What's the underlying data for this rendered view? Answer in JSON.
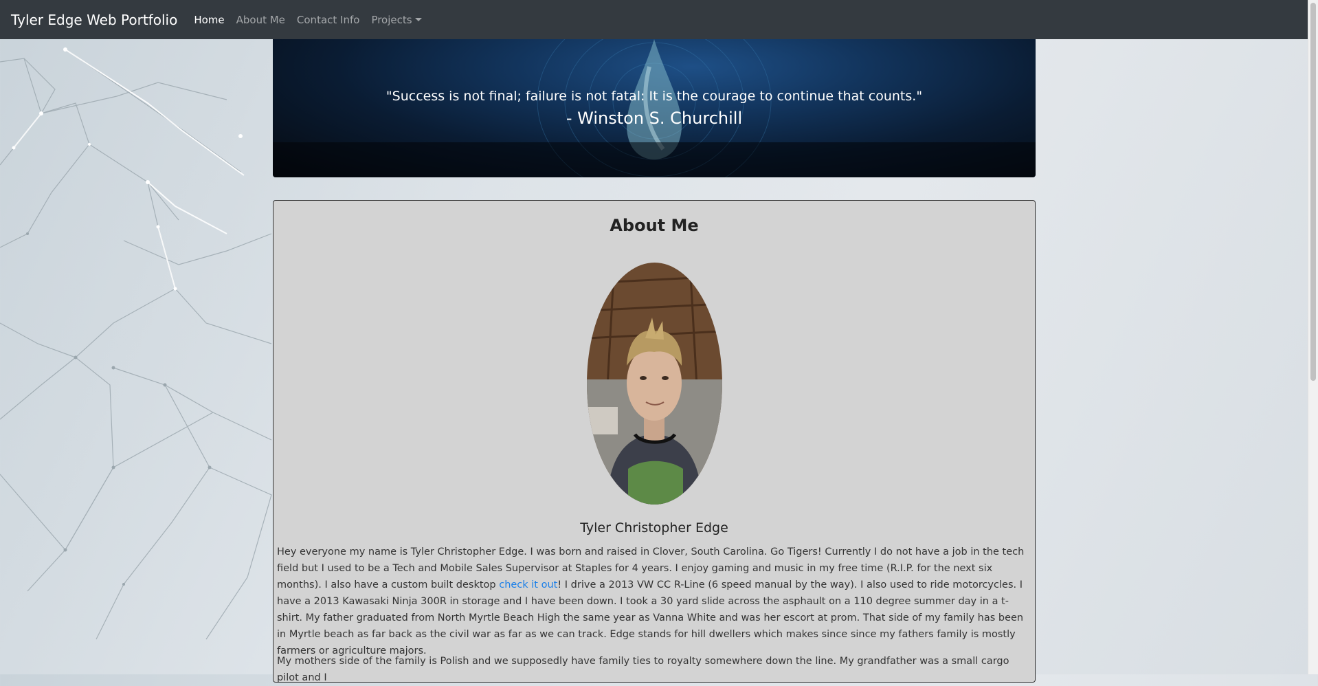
{
  "navbar": {
    "brand": "Tyler Edge Web Portfolio",
    "links": [
      {
        "label": "Home",
        "active": true
      },
      {
        "label": "About Me",
        "active": false
      },
      {
        "label": "Contact Info",
        "active": false
      },
      {
        "label": "Projects",
        "active": false,
        "dropdown": true
      }
    ]
  },
  "hero": {
    "quote": "\"Success is not final; failure is not fatal: It is the courage to continue that counts.\"",
    "author": "- Winston S. Churchill"
  },
  "about": {
    "heading": "About Me",
    "name": "Tyler Christopher Edge",
    "paragraph1_a": "Hey everyone my name is Tyler Christopher Edge. I was born and raised in Clover, South Carolina. Go Tigers! Currently I do not have a job in the tech field but I used to be a Tech and Mobile Sales Supervisor at Staples for 4 years. I enjoy gaming and music in my free time (R.I.P. for the next six months). I also have a custom built desktop ",
    "paragraph1_link": "check it out",
    "paragraph1_b": "! I drive a 2013 VW CC R-Line (6 speed manual by the way). I also used to ride motorcycles. I have a 2013 Kawasaki Ninja 300R in storage and I have been down. I took a 30 yard slide across the asphault on a 110 degree summer day in a t-shirt. My father graduated from North Myrtle Beach High the same year as Vanna White and was her escort at prom. That side of my family has been in Myrtle beach as far back as the civil war as far as we can track. Edge stands for hill dwellers which makes since since my fathers family is mostly farmers or agriculture majors.",
    "paragraph2": "My mothers side of the family is Polish and we supposedly have family ties to royalty somewhere down the line. My grandfather was a small cargo pilot and I"
  },
  "colors": {
    "navbar_bg": "#343a40",
    "card_bg": "#d3d3d3",
    "link": "#1a7fe8"
  }
}
